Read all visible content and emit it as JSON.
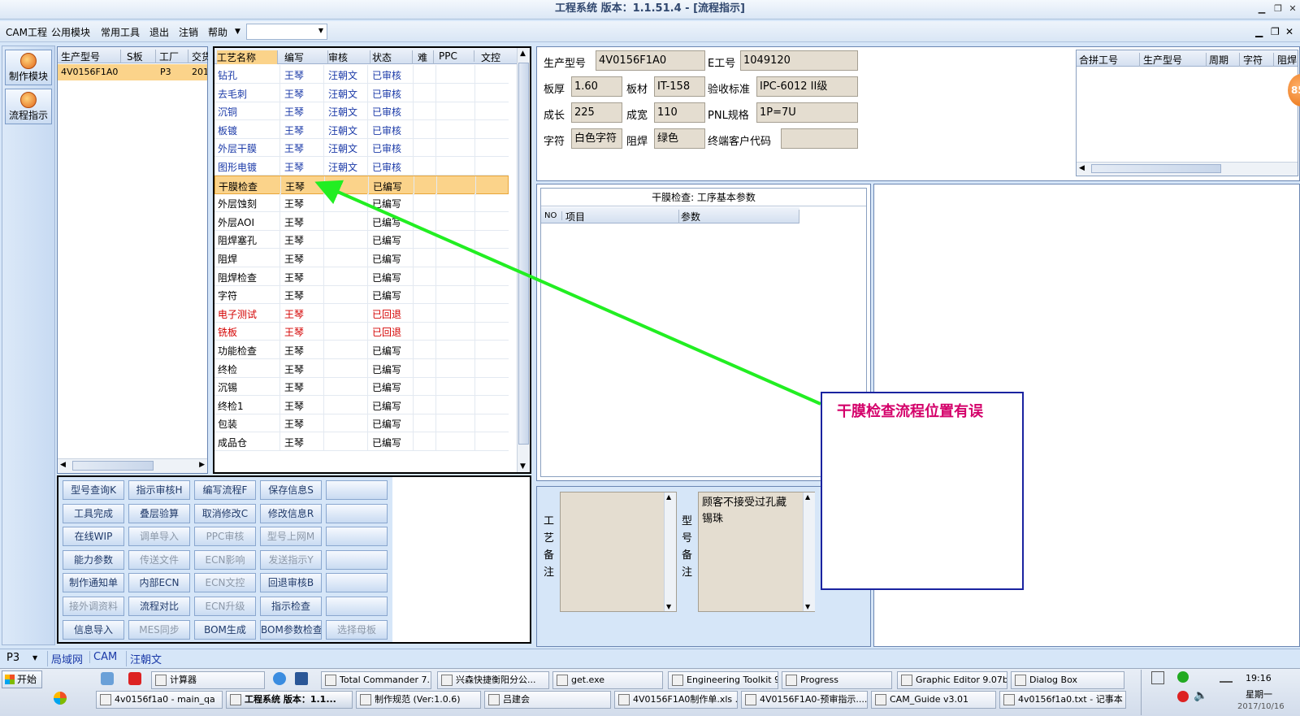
{
  "window": {
    "title": "工程系统   版本：1.1.51.4 - [流程指示]"
  },
  "menu": {
    "items": [
      "CAM工程",
      "公用模块",
      "常用工具",
      "退出",
      "注销",
      "帮助"
    ],
    "combo_value": ""
  },
  "left_toolbar": {
    "buttons": [
      "制作模块",
      "流程指示"
    ]
  },
  "orders": {
    "headers": [
      "生产型号",
      "S板",
      "工厂",
      "交货"
    ],
    "rows": [
      [
        "4V0156F1A0",
        "",
        "P3",
        "201"
      ]
    ]
  },
  "process": {
    "headers": [
      "工艺名称",
      "编写",
      "审核",
      "状态",
      "难",
      "PPC",
      "文控"
    ],
    "rows": [
      {
        "name": "钻孔",
        "writer": "王琴",
        "reviewer": "汪朝文",
        "status": "已审核",
        "style": "blue"
      },
      {
        "name": "去毛刺",
        "writer": "王琴",
        "reviewer": "汪朝文",
        "status": "已审核",
        "style": "blue"
      },
      {
        "name": "沉铜",
        "writer": "王琴",
        "reviewer": "汪朝文",
        "status": "已审核",
        "style": "blue"
      },
      {
        "name": "板镀",
        "writer": "王琴",
        "reviewer": "汪朝文",
        "status": "已审核",
        "style": "blue"
      },
      {
        "name": "外层干膜",
        "writer": "王琴",
        "reviewer": "汪朝文",
        "status": "已审核",
        "style": "blue"
      },
      {
        "name": "图形电镀",
        "writer": "王琴",
        "reviewer": "汪朝文",
        "status": "已审核",
        "style": "blue"
      },
      {
        "name": "干膜检查",
        "writer": "王琴",
        "reviewer": "",
        "status": "已编写",
        "style": "selected"
      },
      {
        "name": "外层蚀刻",
        "writer": "王琴",
        "reviewer": "",
        "status": "已编写",
        "style": "normal"
      },
      {
        "name": "外层AOI",
        "writer": "王琴",
        "reviewer": "",
        "status": "已编写",
        "style": "normal"
      },
      {
        "name": "阻焊塞孔",
        "writer": "王琴",
        "reviewer": "",
        "status": "已编写",
        "style": "normal"
      },
      {
        "name": "阻焊",
        "writer": "王琴",
        "reviewer": "",
        "status": "已编写",
        "style": "normal"
      },
      {
        "name": "阻焊检查",
        "writer": "王琴",
        "reviewer": "",
        "status": "已编写",
        "style": "normal"
      },
      {
        "name": "字符",
        "writer": "王琴",
        "reviewer": "",
        "status": "已编写",
        "style": "normal"
      },
      {
        "name": "电子测试",
        "writer": "王琴",
        "reviewer": "",
        "status": "已回退",
        "style": "red"
      },
      {
        "name": "铣板",
        "writer": "王琴",
        "reviewer": "",
        "status": "已回退",
        "style": "red"
      },
      {
        "name": "功能检查",
        "writer": "王琴",
        "reviewer": "",
        "status": "已编写",
        "style": "normal"
      },
      {
        "name": "终检",
        "writer": "王琴",
        "reviewer": "",
        "status": "已编写",
        "style": "normal"
      },
      {
        "name": "沉锡",
        "writer": "王琴",
        "reviewer": "",
        "status": "已编写",
        "style": "normal"
      },
      {
        "name": "终检1",
        "writer": "王琴",
        "reviewer": "",
        "status": "已编写",
        "style": "normal"
      },
      {
        "name": "包装",
        "writer": "王琴",
        "reviewer": "",
        "status": "已编写",
        "style": "normal"
      },
      {
        "name": "成品仓",
        "writer": "王琴",
        "reviewer": "",
        "status": "已编写",
        "style": "normal"
      }
    ]
  },
  "action_buttons": [
    [
      "型号查询K",
      "指示审核H",
      "编写流程F",
      "保存信息S",
      ""
    ],
    [
      "工具完成",
      "叠层验算",
      "取消修改C",
      "修改信息R",
      ""
    ],
    [
      "在线WIP",
      "调单导入",
      "PPC审核",
      "型号上网M",
      ""
    ],
    [
      "能力参数",
      "传送文件",
      "ECN影响",
      "发送指示Y",
      ""
    ],
    [
      "制作通知单",
      "内部ECN",
      "ECN文控",
      "回退审核B",
      ""
    ],
    [
      "接外调资料",
      "流程对比",
      "ECN升级",
      "指示检查",
      ""
    ],
    [
      "信息导入",
      "MES同步",
      "BOM生成",
      "BOM参数检查",
      "选择母板"
    ]
  ],
  "disabled_buttons": [
    "调单导入",
    "PPC审核",
    "型号上网M",
    "传送文件",
    "ECN影响",
    "发送指示Y",
    "ECN文控",
    "接外调资料",
    "ECN升级",
    "MES同步",
    "选择母板"
  ],
  "info": {
    "model_label": "生产型号",
    "model": "4V0156F1A0",
    "eno_label": "E工号",
    "eno": "1049120",
    "thickness_label": "板厚",
    "thickness": "1.60",
    "material_label": "板材",
    "material": "IT-158",
    "standard_label": "验收标准",
    "standard": "IPC-6012 II级",
    "length_label": "成长",
    "length": "225",
    "width_label": "成宽",
    "width": "110",
    "pnl_label": "PNL规格",
    "pnl": "1P=7U",
    "char_label": "字符",
    "char": "白色字符",
    "mask_label": "阻焊",
    "mask": "绿色",
    "customer_label": "终端客户代码",
    "customer": ""
  },
  "combined": {
    "headers": [
      "合拼工号",
      "生产型号",
      "周期",
      "字符",
      "阻焊"
    ]
  },
  "badge": "85",
  "params": {
    "title": "干膜检查: 工序基本参数",
    "headers": [
      "NO",
      "项目",
      "参数"
    ]
  },
  "remarks": {
    "process_label": [
      "工",
      "艺",
      "备",
      "注"
    ],
    "process_text": "",
    "model_label": [
      "型",
      "号",
      "备",
      "注"
    ],
    "model_text_lines": [
      "顾客不接受过孔藏",
      "锡珠"
    ]
  },
  "annotation": {
    "text": "干膜检查流程位置有误",
    "color": "#d4006a",
    "arrow_color": "#22ee22"
  },
  "statusbar": {
    "plant": "P3",
    "tabs": [
      "局域网",
      "CAM",
      "汪朝文"
    ]
  },
  "taskbar": {
    "start": "开始",
    "row1": [
      "计算器",
      "Total Commander 7....",
      "兴森快捷衡阳分公...",
      "get.exe",
      "Engineering Toolkit 9...",
      "Progress",
      "Graphic Editor 9.07b...",
      "Dialog Box"
    ],
    "row2": [
      "4v0156f1a0 - main_qa",
      "工程系统  版本：1.1...",
      "制作规范 (Ver:1.0.6)",
      "吕建会",
      "4V0156F1A0制作单.xls ...",
      "4V0156F1A0-预审指示....",
      "CAM_Guide v3.01",
      "4v0156f1a0.txt - 记事本"
    ],
    "time": "19:16",
    "day": "星期一",
    "date": "2017/10/16"
  }
}
